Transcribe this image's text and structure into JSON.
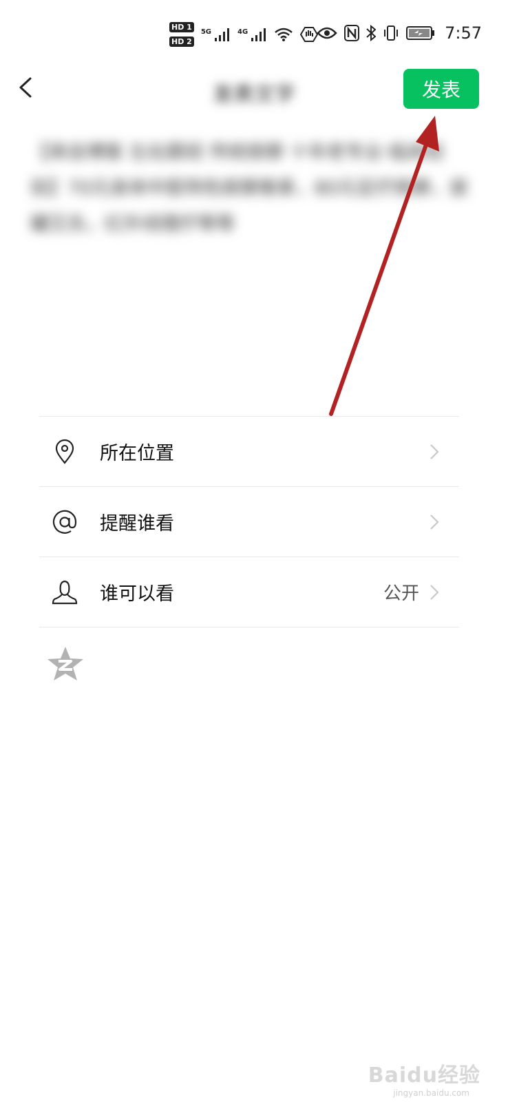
{
  "status_bar": {
    "sim1": "HD 1",
    "sim2": "HD 2",
    "net1": "5G",
    "net2": "4G",
    "time": "7:57"
  },
  "nav": {
    "title_blurred": "发表文字",
    "publish_label": "发表",
    "accent_color": "#07c160"
  },
  "post": {
    "text_blurred": "【来自博客 左右跟班 传统按摩 十年老专业·临床经验】70元身体中医特色按摩推拿，80元足疗按摩，拔罐艾灸，红外线理疗等等"
  },
  "options": [
    {
      "icon": "location-pin-icon",
      "label": "所在位置",
      "value": ""
    },
    {
      "icon": "at-sign-icon",
      "label": "提醒谁看",
      "value": ""
    },
    {
      "icon": "person-icon",
      "label": "谁可以看",
      "value": "公开"
    }
  ],
  "extra": {
    "icon": "qzone-star-icon"
  },
  "watermark": {
    "text": "Baidu经验",
    "sub": "jingyan.baidu.com"
  }
}
